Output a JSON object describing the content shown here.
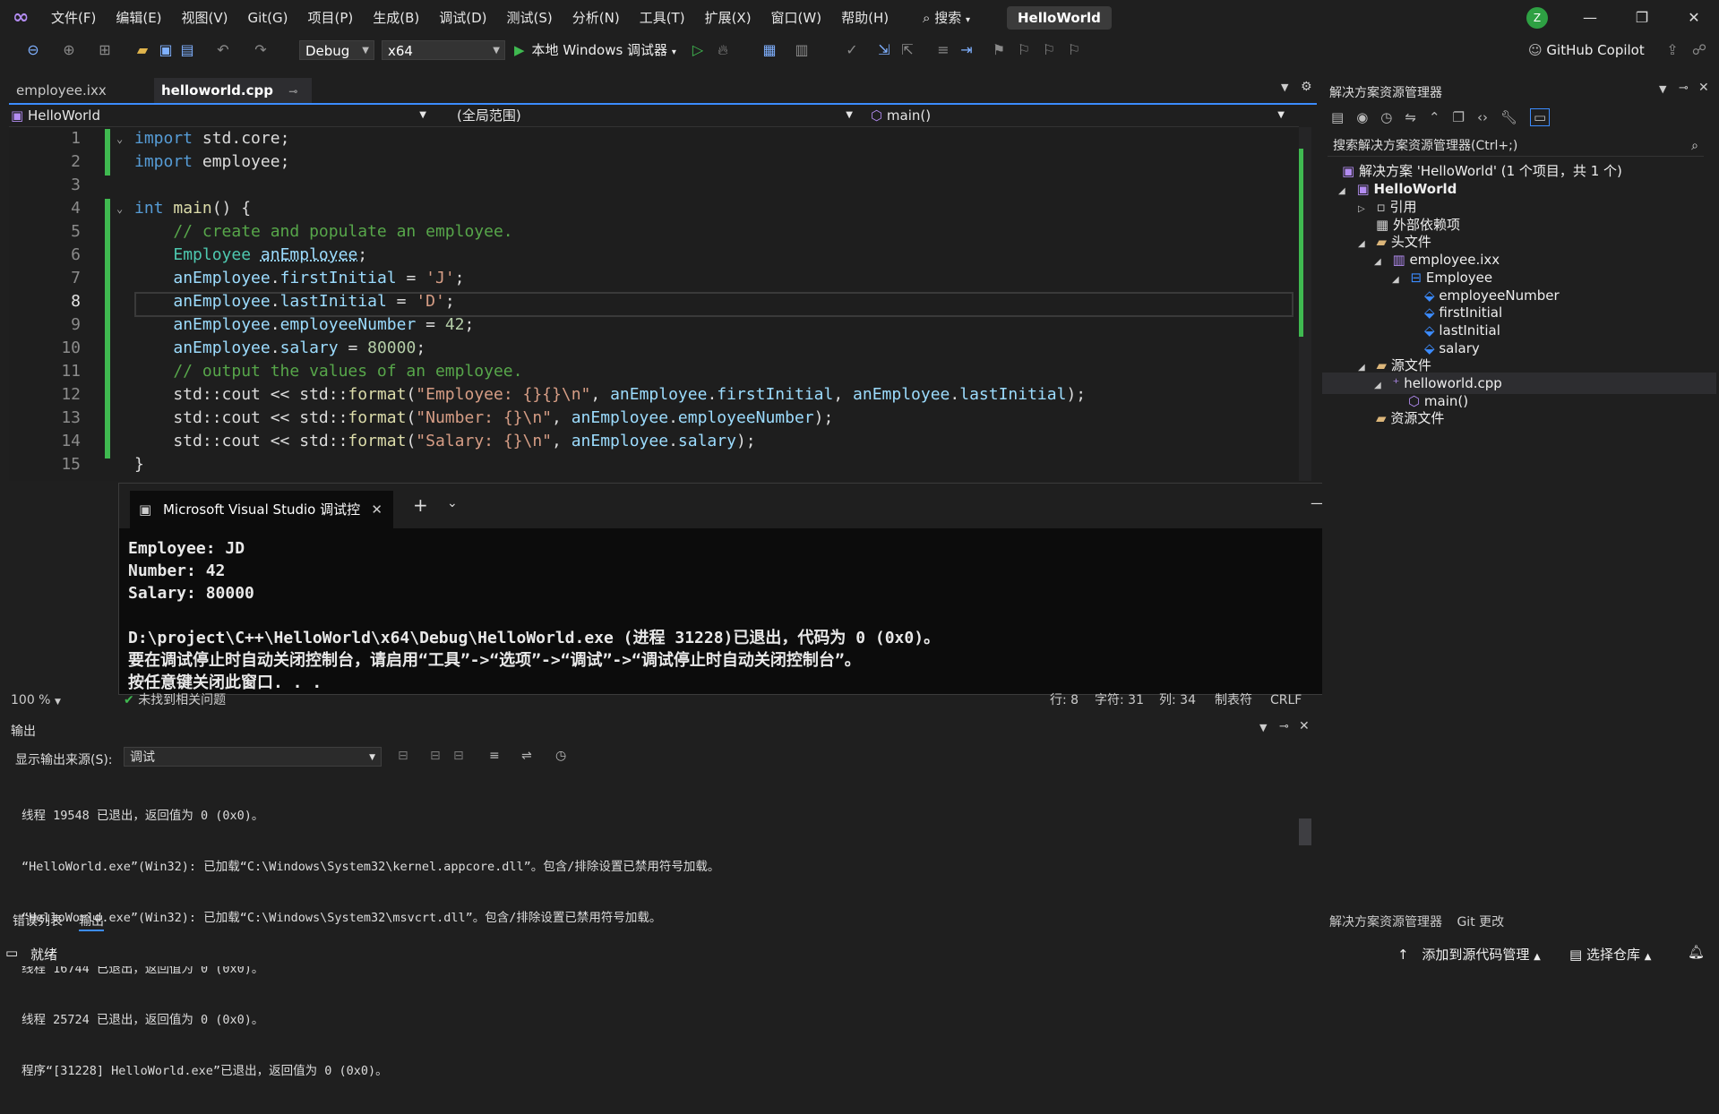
{
  "menu": {
    "items": [
      "文件(F)",
      "编辑(E)",
      "视图(V)",
      "Git(G)",
      "项目(P)",
      "生成(B)",
      "调试(D)",
      "测试(S)",
      "分析(N)",
      "工具(T)",
      "扩展(X)",
      "窗口(W)",
      "帮助(H)"
    ],
    "search_label": "搜索",
    "solution_name": "HelloWorld",
    "user_initial": "Z"
  },
  "toolbar": {
    "config": "Debug",
    "platform": "x64",
    "run_label": "本地 Windows 调试器",
    "copilot_label": "GitHub Copilot"
  },
  "editor": {
    "tabs": [
      {
        "label": "employee.ixx",
        "active": false
      },
      {
        "label": "helloworld.cpp",
        "active": true
      }
    ],
    "nav": {
      "project": "HelloWorld",
      "scope": "(全局范围)",
      "member": "main()"
    },
    "current_line": 8,
    "lines": [
      {
        "n": "1",
        "text": "import std.core;"
      },
      {
        "n": "2",
        "text": "import employee;"
      },
      {
        "n": "3",
        "text": ""
      },
      {
        "n": "4",
        "text": "int main() {"
      },
      {
        "n": "5",
        "text": "    // create and populate an employee."
      },
      {
        "n": "6",
        "text": "    Employee anEmployee;"
      },
      {
        "n": "7",
        "text": "    anEmployee.firstInitial = 'J';"
      },
      {
        "n": "8",
        "text": "    anEmployee.lastInitial = 'D';"
      },
      {
        "n": "9",
        "text": "    anEmployee.employeeNumber = 42;"
      },
      {
        "n": "10",
        "text": "    anEmployee.salary = 80000;"
      },
      {
        "n": "11",
        "text": "    // output the values of an employee."
      },
      {
        "n": "12",
        "text": "    std::cout << std::format(\"Employee: {}{}\\n\", anEmployee.firstInitial, anEmployee.lastInitial);"
      },
      {
        "n": "13",
        "text": "    std::cout << std::format(\"Number: {}\\n\", anEmployee.employeeNumber);"
      },
      {
        "n": "14",
        "text": "    std::cout << std::format(\"Salary: {}\\n\", anEmployee.salary);"
      },
      {
        "n": "15",
        "text": "}"
      }
    ],
    "status": {
      "zoom": "100 %",
      "issues": "未找到相关问题",
      "line": "行: 8",
      "char": "字符: 31",
      "col": "列: 34",
      "tabs": "制表符",
      "eol": "CRLF"
    }
  },
  "console": {
    "title": "Microsoft Visual Studio 调试控",
    "lines": [
      "Employee: JD",
      "Number: 42",
      "Salary: 80000",
      "",
      "D:\\project\\C++\\HelloWorld\\x64\\Debug\\HelloWorld.exe (进程 31228)已退出，代码为 0 (0x0)。",
      "要在调试停止时自动关闭控制台，请启用“工具”->“选项”->“调试”->“调试停止时自动关闭控制台”。",
      "按任意键关闭此窗口. . ."
    ]
  },
  "output": {
    "title": "输出",
    "source_label": "显示输出来源(S):",
    "source_value": "调试",
    "lines": [
      "线程 19548 已退出，返回值为 0 (0x0)。",
      "“HelloWorld.exe”(Win32): 已加载“C:\\Windows\\System32\\kernel.appcore.dll”。包含/排除设置已禁用符号加载。",
      "“HelloWorld.exe”(Win32): 已加载“C:\\Windows\\System32\\msvcrt.dll”。包含/排除设置已禁用符号加载。",
      "线程 16744 已退出，返回值为 0 (0x0)。",
      "线程 25724 已退出，返回值为 0 (0x0)。",
      "程序“[31228] HelloWorld.exe”已退出，返回值为 0 (0x0)。"
    ],
    "bottom_tabs": [
      "错误列表",
      "输出"
    ]
  },
  "solution_explorer": {
    "title": "解决方案资源管理器",
    "search_placeholder": "搜索解决方案资源管理器(Ctrl+;)",
    "nodes": [
      {
        "label": "解决方案 'HelloWorld' (1 个项目，共 1 个)",
        "depth": 0,
        "bold": false,
        "icon": "solution-icon"
      },
      {
        "label": "HelloWorld",
        "depth": 1,
        "bold": true,
        "icon": "project-icon",
        "expanded": true
      },
      {
        "label": "引用",
        "depth": 2,
        "bold": false,
        "icon": "references-icon",
        "expanded": false
      },
      {
        "label": "外部依赖项",
        "depth": 2,
        "bold": false,
        "icon": "external-deps-icon"
      },
      {
        "label": "头文件",
        "depth": 2,
        "bold": false,
        "icon": "folder-icon",
        "expanded": true
      },
      {
        "label": "employee.ixx",
        "depth": 3,
        "bold": false,
        "icon": "module-file-icon",
        "expanded": true
      },
      {
        "label": "Employee",
        "depth": 4,
        "bold": false,
        "icon": "struct-icon",
        "expanded": true
      },
      {
        "label": "employeeNumber",
        "depth": 5,
        "bold": false,
        "icon": "field-icon"
      },
      {
        "label": "firstInitial",
        "depth": 5,
        "bold": false,
        "icon": "field-icon"
      },
      {
        "label": "lastInitial",
        "depth": 5,
        "bold": false,
        "icon": "field-icon"
      },
      {
        "label": "salary",
        "depth": 5,
        "bold": false,
        "icon": "field-icon"
      },
      {
        "label": "源文件",
        "depth": 2,
        "bold": false,
        "icon": "folder-icon",
        "expanded": true
      },
      {
        "label": "helloworld.cpp",
        "depth": 3,
        "bold": false,
        "icon": "cpp-file-icon",
        "expanded": true,
        "selected": true
      },
      {
        "label": "main()",
        "depth": 4,
        "bold": false,
        "icon": "function-icon"
      },
      {
        "label": "资源文件",
        "depth": 2,
        "bold": false,
        "icon": "folder-icon"
      }
    ],
    "bottom_tabs": [
      "解决方案资源管理器",
      "Git 更改"
    ]
  },
  "statusbar": {
    "ready": "就绪",
    "add_source_control": "添加到源代码管理",
    "select_repo": "选择仓库"
  },
  "colors": {
    "accent": "#3c8cff",
    "gutter_change": "#3fb950",
    "keyword": "#569cd6",
    "comment": "#57a64a",
    "string": "#d69d85"
  }
}
